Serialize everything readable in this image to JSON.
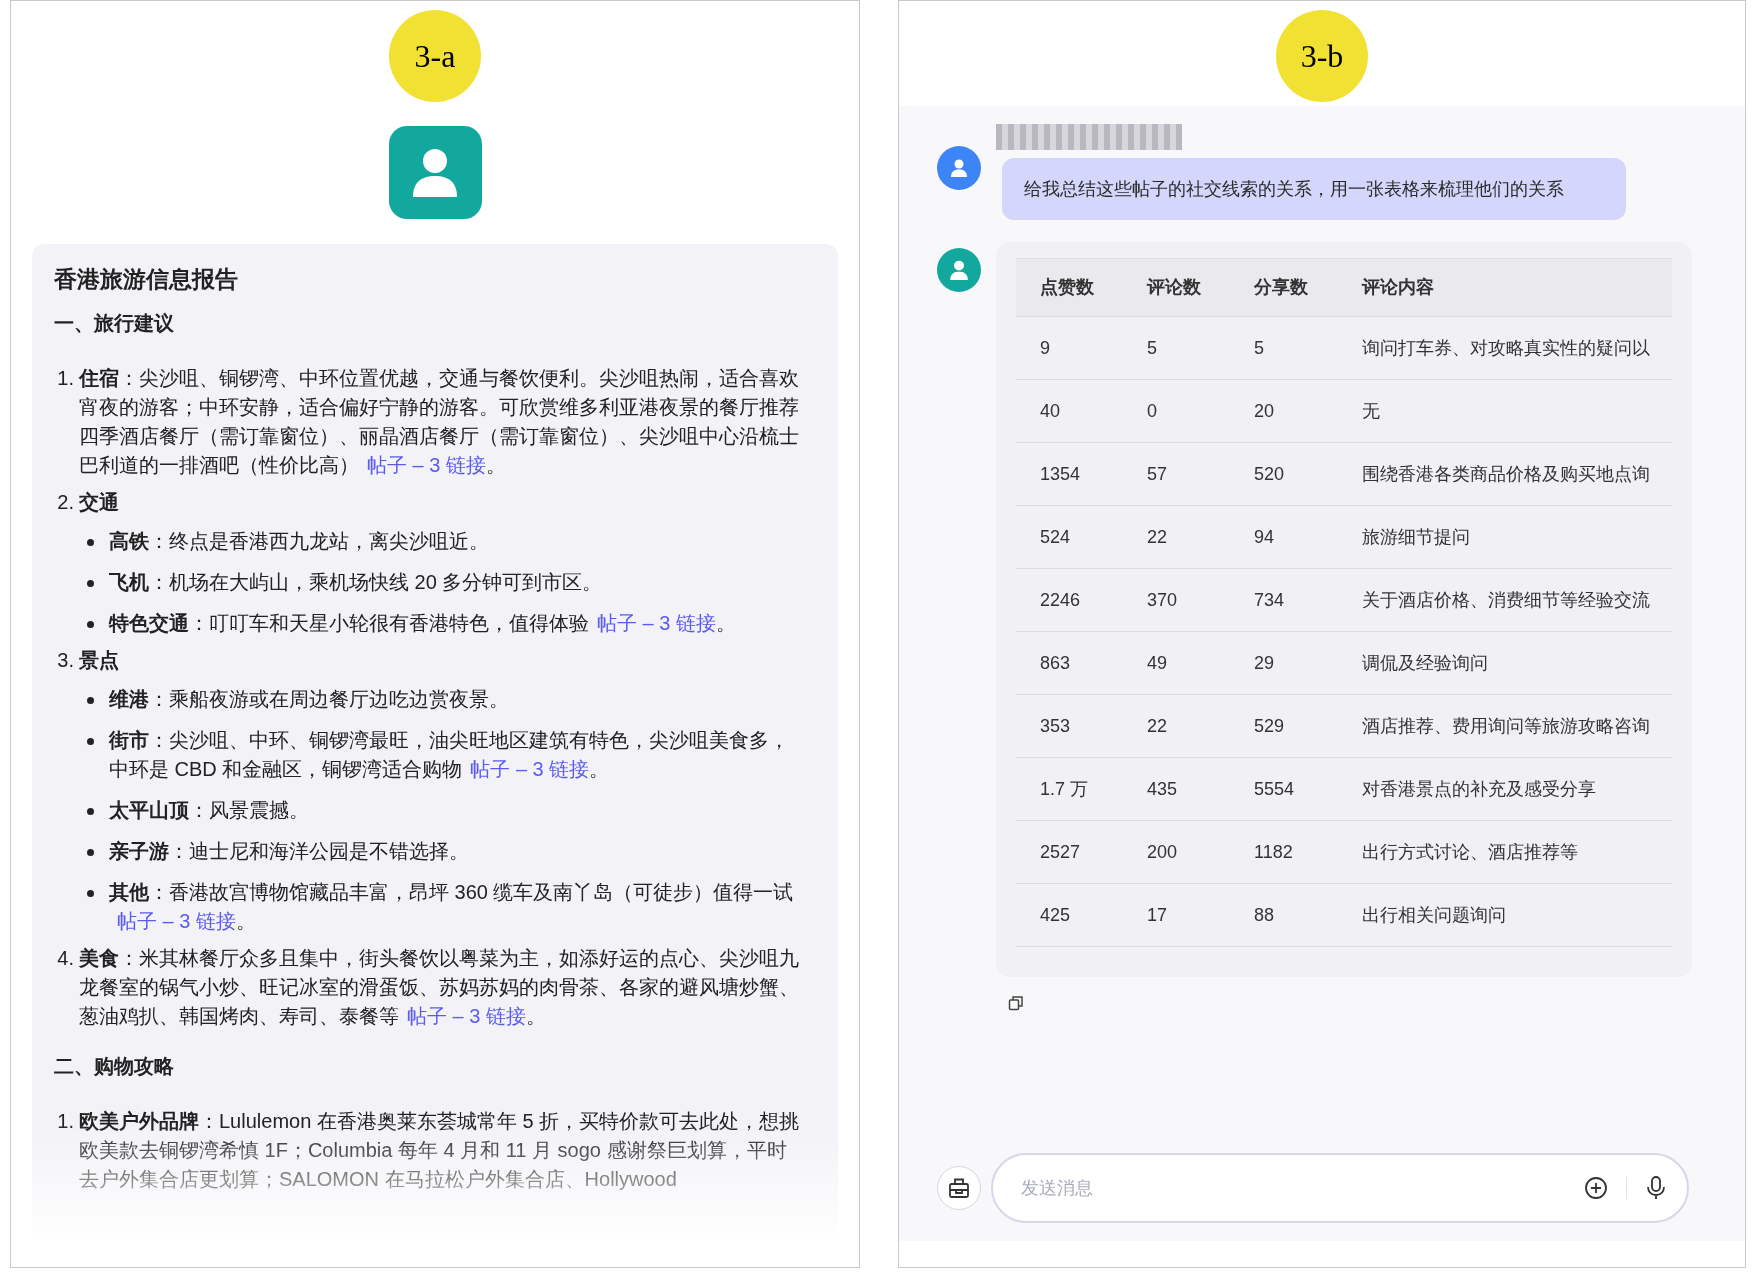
{
  "panel_a": {
    "label": "3-a",
    "report": {
      "title": "香港旅游信息报告",
      "sections": [
        {
          "heading": "一、旅行建议",
          "items": [
            {
              "number": "1.",
              "term": "住宿",
              "text": "：尖沙咀、铜锣湾、中环位置优越，交通与餐饮便利。尖沙咀热闹，适合喜欢宵夜的游客；中环安静，适合偏好宁静的游客。可欣赏维多利亚港夜景的餐厅推荐四季酒店餐厅（需订靠窗位）、丽晶酒店餐厅（需订靠窗位）、尖沙咀中心沿梳士巴利道的一排酒吧（性价比高）",
              "link": "帖子 – 3 链接",
              "after": "。"
            },
            {
              "number": "2.",
              "term": "交通",
              "children": [
                {
                  "term": "高铁",
                  "text": "：终点是香港西九龙站，离尖沙咀近。"
                },
                {
                  "term": "飞机",
                  "text": "：机场在大屿山，乘机场快线 20 多分钟可到市区。"
                },
                {
                  "term": "特色交通",
                  "text": "：叮叮车和天星小轮很有香港特色，值得体验",
                  "link": "帖子 – 3 链接",
                  "after": "。"
                }
              ]
            },
            {
              "number": "3.",
              "term": "景点",
              "children": [
                {
                  "term": "维港",
                  "text": "：乘船夜游或在周边餐厅边吃边赏夜景。"
                },
                {
                  "term": "街市",
                  "text": "：尖沙咀、中环、铜锣湾最旺，油尖旺地区建筑有特色，尖沙咀美食多，中环是 CBD 和金融区，铜锣湾适合购物",
                  "link": "帖子 – 3 链接",
                  "after": "。"
                },
                {
                  "term": "太平山顶",
                  "text": "：风景震撼。"
                },
                {
                  "term": "亲子游",
                  "text": "：迪士尼和海洋公园是不错选择。"
                },
                {
                  "term": "其他",
                  "text": "：香港故宫博物馆藏品丰富，昂坪 360 缆车及南丫岛（可徒步）值得一试",
                  "link": "帖子 – 3 链接",
                  "after": "。"
                }
              ]
            },
            {
              "number": "4.",
              "term": "美食",
              "text": "：米其林餐厅众多且集中，街头餐饮以粤菜为主，如添好运的点心、尖沙咀九龙餐室的锅气小炒、旺记冰室的滑蛋饭、苏妈苏妈的肉骨茶、各家的避风塘炒蟹、葱油鸡扒、韩国烤肉、寿司、泰餐等",
              "link": "帖子 – 3 链接",
              "after": "。"
            }
          ]
        },
        {
          "heading": "二、购物攻略",
          "items": [
            {
              "number": "1.",
              "term": "欧美户外品牌",
              "text": "：Lululemon 在香港奥莱东荟城常年 5 折，买特价款可去此处，想挑欧美款去铜锣湾希慎 1F；Columbia 每年 4 月和 11 月 sogo 感谢祭巨划算，平时去户外集合店更划算；SALOMON 在马拉松户外集合店、Hollywood"
            }
          ]
        }
      ]
    }
  },
  "panel_b": {
    "label": "3-b",
    "user_message": "给我总结这些帖子的社交线索的关系，用一张表格来梳理他们的关系",
    "table": {
      "columns": [
        "点赞数",
        "评论数",
        "分享数",
        "评论内容"
      ],
      "rows": [
        [
          "9",
          "5",
          "5",
          "询问打车券、对攻略真实性的疑问以"
        ],
        [
          "40",
          "0",
          "20",
          "无"
        ],
        [
          "1354",
          "57",
          "520",
          "围绕香港各类商品价格及购买地点询"
        ],
        [
          "524",
          "22",
          "94",
          "旅游细节提问"
        ],
        [
          "2246",
          "370",
          "734",
          "关于酒店价格、消费细节等经验交流"
        ],
        [
          "863",
          "49",
          "29",
          "调侃及经验询问"
        ],
        [
          "353",
          "22",
          "529",
          "酒店推荐、费用询问等旅游攻略咨询"
        ],
        [
          "1.7 万",
          "435",
          "5554",
          "对香港景点的补充及感受分享"
        ],
        [
          "2527",
          "200",
          "1182",
          "出行方式讨论、酒店推荐等"
        ],
        [
          "425",
          "17",
          "88",
          "出行相关问题询问"
        ]
      ]
    },
    "input": {
      "placeholder": "发送消息"
    }
  }
}
